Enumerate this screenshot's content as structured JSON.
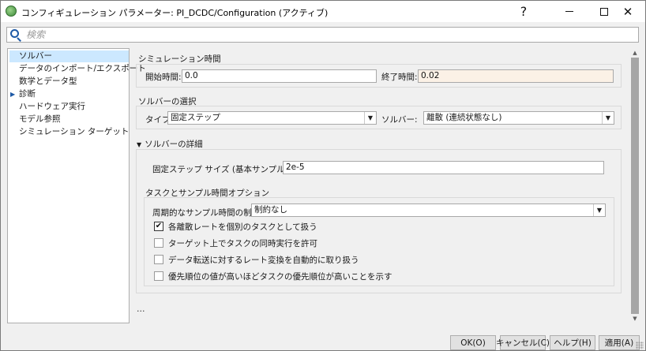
{
  "window": {
    "title": "コンフィギュレーション パラメーター: PI_DCDC/Configuration (アクティブ)",
    "help_glyph": "?",
    "close_glyph": "✕"
  },
  "search": {
    "placeholder": "検索",
    "value": ""
  },
  "tree": {
    "items": [
      {
        "label": "ソルバー",
        "selected": true
      },
      {
        "label": "データのインポート/エクスポート"
      },
      {
        "label": "数学とデータ型"
      },
      {
        "label": "診断",
        "expandable": true
      },
      {
        "label": "ハードウェア実行"
      },
      {
        "label": "モデル参照"
      },
      {
        "label": "シミュレーション ターゲット"
      }
    ],
    "expand_glyph": "▶"
  },
  "sim_time": {
    "title": "シミュレーション時間",
    "start_label": "開始時間:",
    "start_value": "0.0",
    "stop_label": "終了時間:",
    "stop_value": "0.02"
  },
  "solver_select": {
    "title": "ソルバーの選択",
    "type_label": "タイプ:",
    "type_value": "固定ステップ",
    "solver_label": "ソルバー:",
    "solver_value": "離散 (連続状態なし)"
  },
  "solver_details": {
    "title": "ソルバーの詳細",
    "collapse_glyph": "▼",
    "step_size_label": "固定ステップ サイズ (基本サンプル時間):",
    "step_size_value": "2e-5",
    "tasking": {
      "title": "タスクとサンプル時間オプション",
      "constraint_label": "周期的なサンプル時間の制約:",
      "constraint_value": "制約なし",
      "checkboxes": [
        {
          "label": "各離散レートを個別のタスクとして扱う",
          "checked": true
        },
        {
          "label": "ターゲット上でタスクの同時実行を許可",
          "checked": false
        },
        {
          "label": "データ転送に対するレート変換を自動的に取り扱う",
          "checked": false
        },
        {
          "label": "優先順位の値が高いほどタスクの優先順位が高いことを示す",
          "checked": false
        }
      ]
    }
  },
  "more": "...",
  "combo_glyph": "▼",
  "scroll": {
    "up_glyph": "▲",
    "down_glyph": "▼"
  },
  "check_glyph": "✔",
  "buttons": {
    "ok": "OK(O)",
    "cancel": "キャンセル(C)",
    "help": "ヘルプ(H)",
    "apply": "適用(A)"
  }
}
